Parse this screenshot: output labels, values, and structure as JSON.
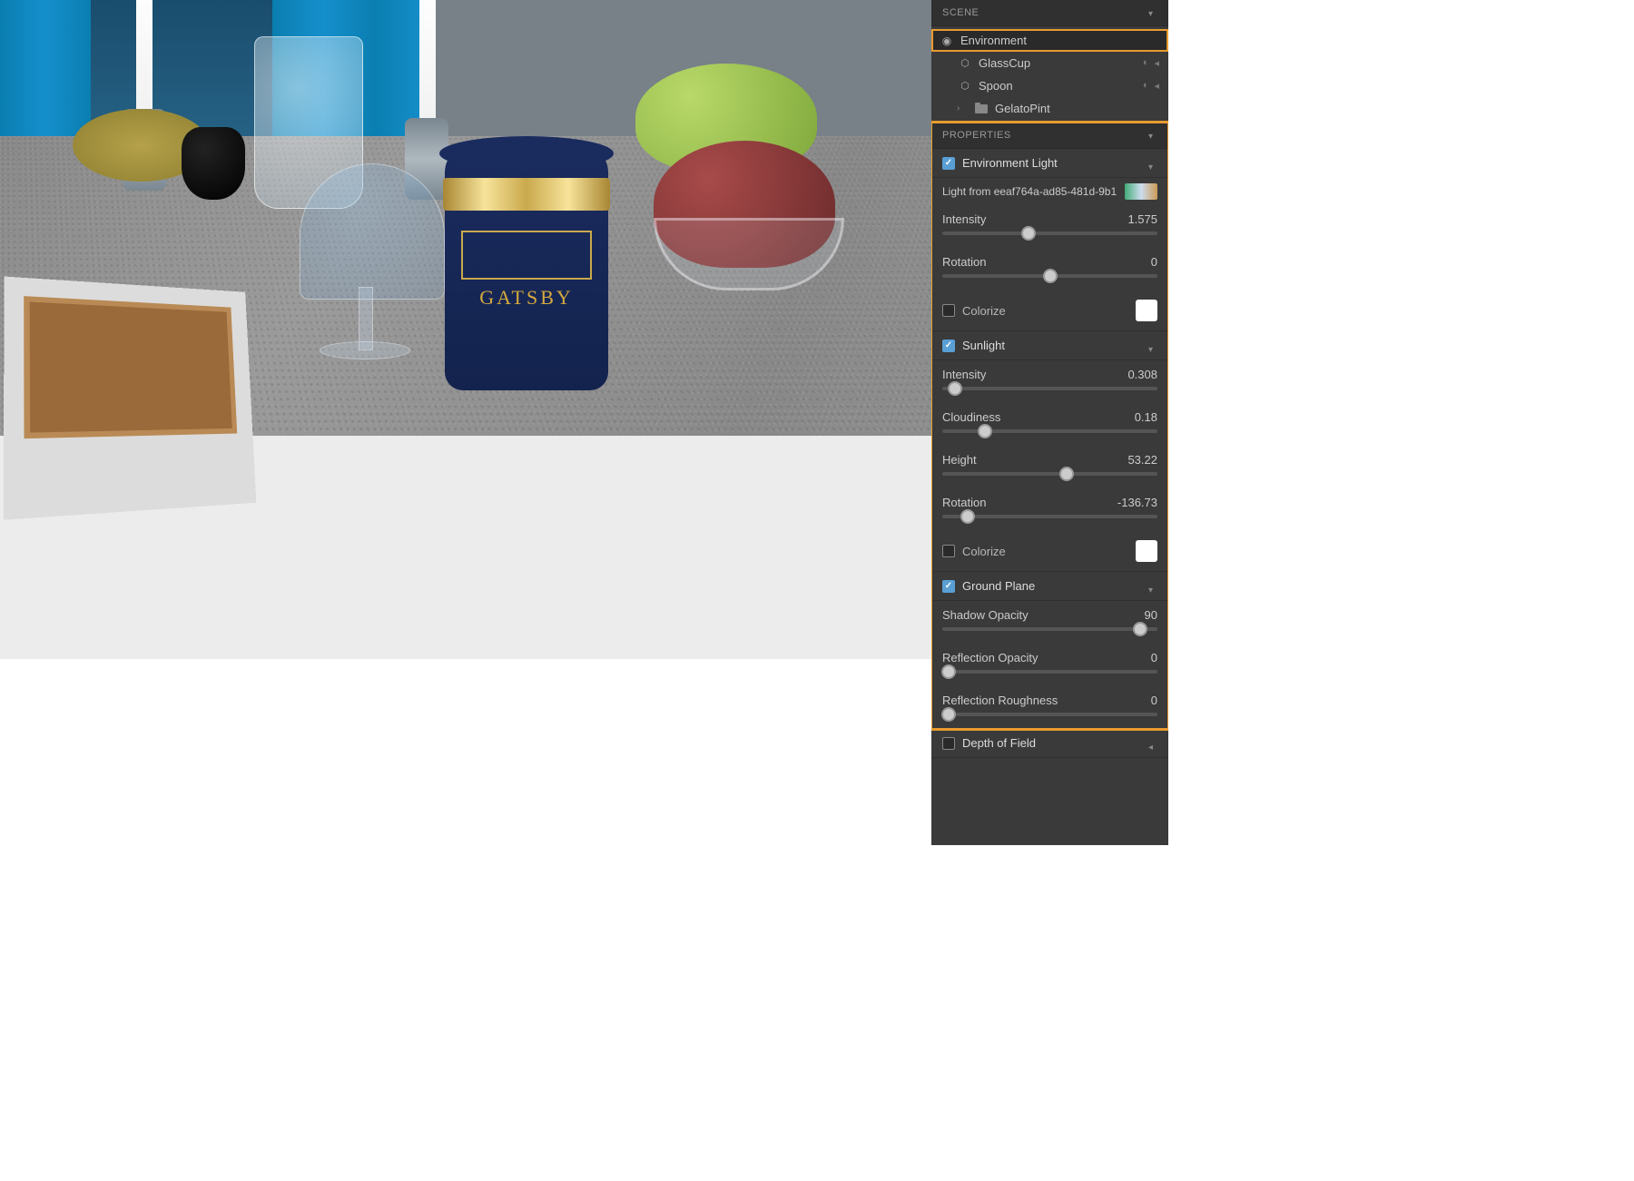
{
  "scene": {
    "panel_label": "SCENE",
    "items": [
      {
        "label": "Environment",
        "icon": "globe",
        "selected": true
      },
      {
        "label": "GlassCup",
        "icon": "cube",
        "child": true,
        "visibility": true
      },
      {
        "label": "Spoon",
        "icon": "cube",
        "child": true,
        "visibility": true
      },
      {
        "label": "GelatoPint",
        "icon": "folder",
        "expandable": true
      }
    ]
  },
  "properties": {
    "panel_label": "PROPERTIES",
    "environment_light": {
      "title": "Environment Light",
      "checked": true,
      "light_from_label": "Light from eeaf764a-ad85-481d-9b1",
      "intensity": {
        "label": "Intensity",
        "value": "1.575",
        "pos": 40
      },
      "rotation": {
        "label": "Rotation",
        "value": "0",
        "pos": 50
      },
      "colorize": {
        "label": "Colorize",
        "checked": false,
        "color": "#ffffff"
      }
    },
    "sunlight": {
      "title": "Sunlight",
      "checked": true,
      "intensity": {
        "label": "Intensity",
        "value": "0.308",
        "pos": 6
      },
      "cloudiness": {
        "label": "Cloudiness",
        "value": "0.18",
        "pos": 20
      },
      "height": {
        "label": "Height",
        "value": "53.22",
        "pos": 58
      },
      "rotation": {
        "label": "Rotation",
        "value": "-136.73",
        "pos": 12
      },
      "colorize": {
        "label": "Colorize",
        "checked": false,
        "color": "#ffffff"
      }
    },
    "ground_plane": {
      "title": "Ground Plane",
      "checked": true,
      "shadow_opacity": {
        "label": "Shadow Opacity",
        "value": "90",
        "pos": 92
      },
      "reflection_opacity": {
        "label": "Reflection Opacity",
        "value": "0",
        "pos": 3
      },
      "reflection_roughness": {
        "label": "Reflection Roughness",
        "value": "0",
        "pos": 3
      }
    },
    "depth_of_field": {
      "title": "Depth of Field",
      "checked": false
    }
  },
  "viewport": {
    "product_label": "GATSBY"
  }
}
